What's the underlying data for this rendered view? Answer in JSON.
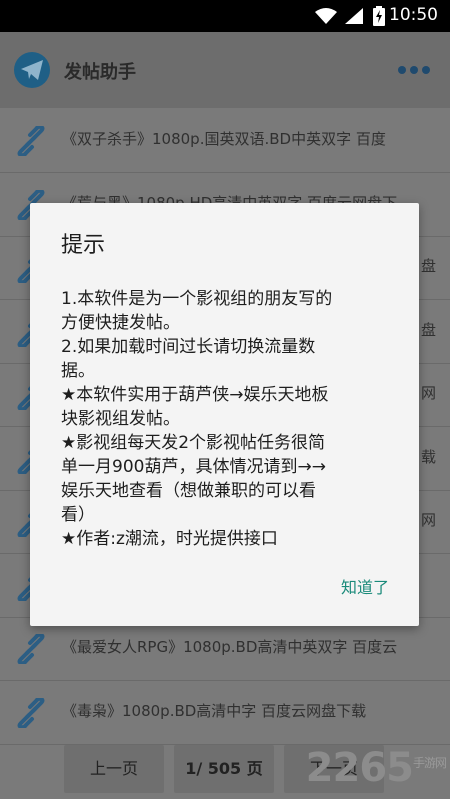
{
  "status_bar": {
    "time": "10:50"
  },
  "app": {
    "title": "发帖助手"
  },
  "list_items": [
    "《双子杀手》1080p.国英双语.BD中英双字 百度",
    "《荒与黑》1080p.HD高清中英双字 百度云网盘下",
    "",
    "",
    "",
    "",
    "",
    "",
    "《最爱女人RPG》1080p.BD高清中英双字 百度云",
    "《毒枭》1080p.BD高清中字 百度云网盘下载"
  ],
  "list_item_right_fragments": [
    "",
    "",
    "盘",
    "盘",
    "网",
    "载",
    "网",
    "",
    "",
    ""
  ],
  "pager": {
    "prev": "上一页",
    "page": "1/ 505 页",
    "next": "下一页"
  },
  "watermark": {
    "brand": "2265",
    "sub": "手游网"
  },
  "dialog": {
    "title": "提示",
    "lines": [
      "1.本软件是为一个影视组的朋友写的",
      "方便快捷发帖。",
      "2.如果加载时间过长请切换流量数",
      "据。",
      "★本软件实用于葫芦侠→娱乐天地板",
      "块影视组发帖。",
      "★影视组每天发2个影视帖任务很简",
      "单一月900葫芦，具体情况请到→→",
      "娱乐天地查看（想做兼职的可以看",
      "看）",
      "★作者:z潮流，时光提供接口"
    ],
    "ok": "知道了"
  },
  "colors": {
    "accent": "#1a8a7a",
    "logo": "#1f5f86",
    "link_icon": "#2c6a95"
  },
  "icons": [
    "wifi-icon",
    "signal-icon",
    "battery-icon",
    "telegram-plane-icon",
    "more-dots-icon",
    "link-icon"
  ]
}
